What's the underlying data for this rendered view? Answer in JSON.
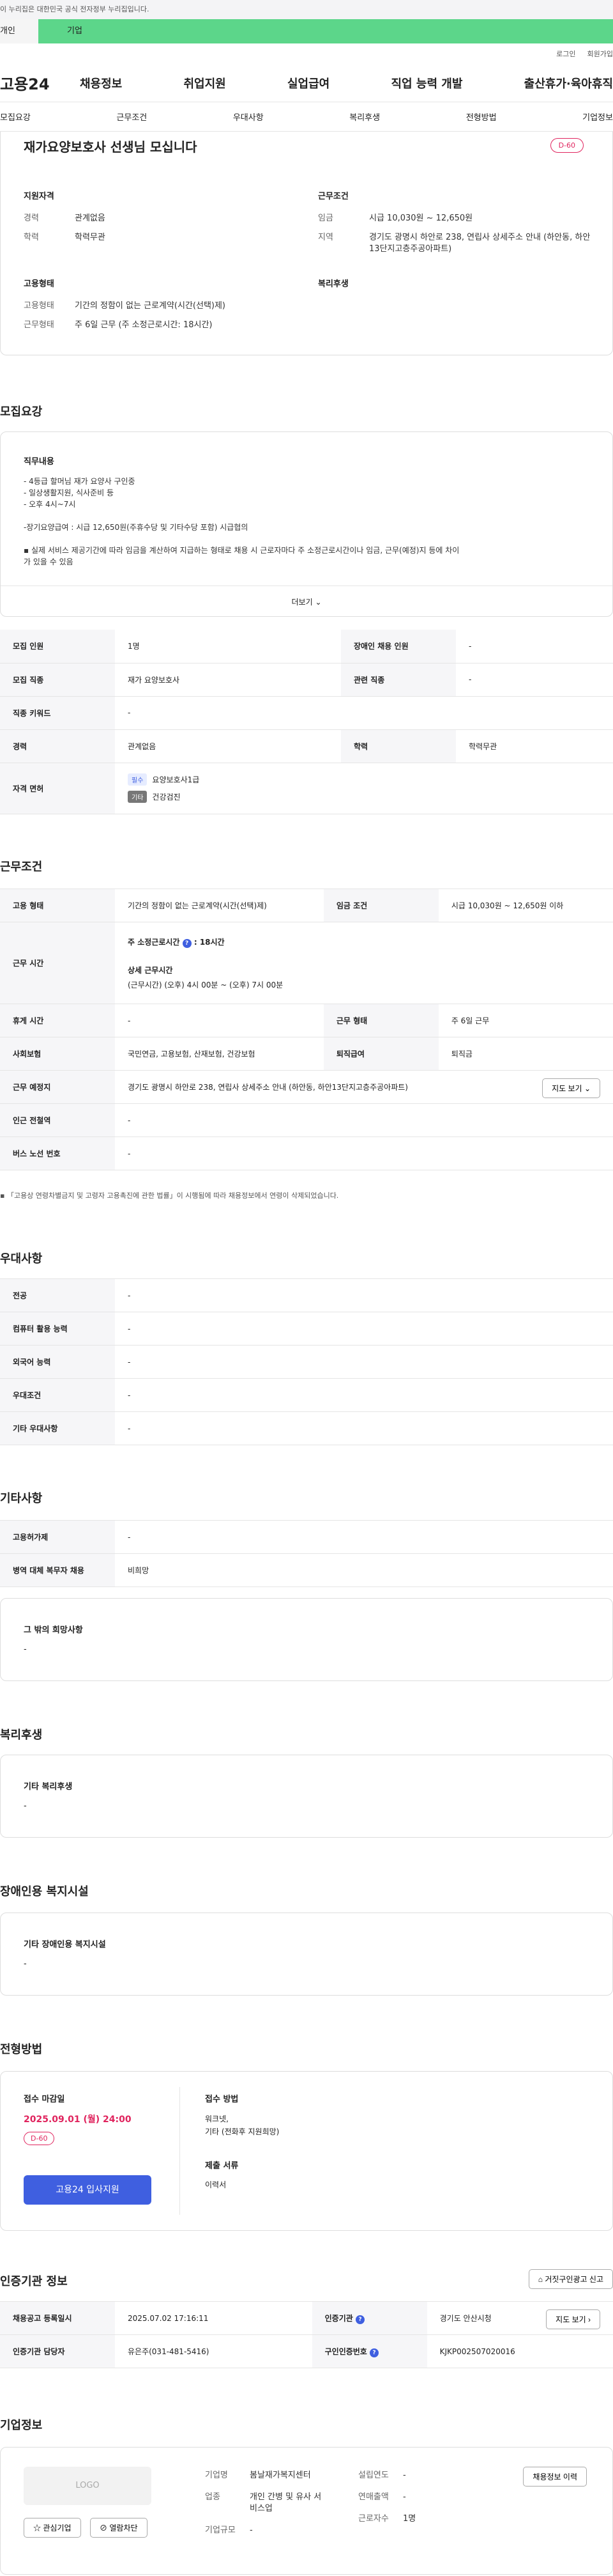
{
  "gov_banner": "이 누리집은 대한민국 공식 전자정부 누리집입니다.",
  "top_tabs": {
    "individual": "개인",
    "corporate": "기업"
  },
  "util": {
    "login": "로그인",
    "signup": "회원가입"
  },
  "gnb": {
    "logo": "고용24",
    "menu": [
      "채용정보",
      "취업지원",
      "실업급여",
      "직업 능력 개발",
      "출산휴가·육아휴직"
    ]
  },
  "subnav": [
    "모집요강",
    "근무조건",
    "우대사항",
    "복리후생",
    "전형방법",
    "기업정보"
  ],
  "header": {
    "title": "재가요양보호사 선생님 모십니다",
    "dday": "D-60",
    "qual_head": "지원자격",
    "qual": [
      {
        "k": "경력",
        "v": "관계없음"
      },
      {
        "k": "학력",
        "v": "학력무관"
      }
    ],
    "cond_head": "근무조건",
    "cond": [
      {
        "k": "임금",
        "v": "시급 10,030원 ~ 12,650원"
      },
      {
        "k": "지역",
        "v": "경기도 광명시 하안로 238, 연립사 상세주소 안내 (하안동, 하안13단지고층주공아파트)"
      }
    ],
    "emp_head": "고용형태",
    "emp": [
      {
        "k": "고용형태",
        "v": "기간의 정함이 없는 근로계약(시간(선택)제)"
      },
      {
        "k": "근무형태",
        "v": "주 6일 근무 (주 소정근로시간: 18시간)"
      }
    ],
    "welfare_head": "복리후생"
  },
  "recruit": {
    "title": "모집요강",
    "duty_head": "직무내용",
    "duty_lines": [
      "- 4등급 할머님 재가 요양사 구인중",
      "- 일상생활지원, 식사준비 등",
      "- 오후 4시~7시",
      "",
      "-장기요양급여 : 시급 12,650원(주휴수당 및 기타수당 포함) 시급협의",
      "",
      "▪ 실제 서비스 제공기간에 따라 임금을 계산하여 지급하는 형태로 채용 시 근로자마다 주 소정근로시간이나 임금, 근무(예정)지 등에 차이",
      "가 있을 수 있음"
    ],
    "more": "더보기",
    "rows": [
      {
        "h1": "모집 인원",
        "v1": "1명",
        "h2": "장애인 채용 인원",
        "v2": "-"
      },
      {
        "h1": "모집 직종",
        "v1": "재가 요양보호사",
        "h2": "관련 직종",
        "v2": "-"
      },
      {
        "h1": "직종 키워드",
        "v1": "-"
      },
      {
        "h1": "경력",
        "v1": "관계없음",
        "h2": "학력",
        "v2": "학력무관"
      }
    ],
    "license_head": "자격 면허",
    "licenses": [
      {
        "tag": "필수",
        "name": "요양보호사1급"
      },
      {
        "tag": "기타",
        "name": "건강검진"
      }
    ]
  },
  "work": {
    "title": "근무조건",
    "emp_type_h": "고용 형태",
    "emp_type": "기간의 정함이 없는 근로계약(시간(선택)제)",
    "wage_h": "임금 조건",
    "wage": "시급 10,030원 ~ 12,650원 이하",
    "hours_h": "근무 시간",
    "hours_main": "주 소정근로시간",
    "hours_val": ": 18시간",
    "hours_detail_h": "상세 근무시간",
    "hours_detail": "(근무시간) (오후) 4시 00분 ~ (오후) 7시 00분",
    "break_h": "휴게 시간",
    "break": "-",
    "shift_h": "근무 형태",
    "shift": "주 6일 근무",
    "ins_h": "사회보험",
    "ins": "국민연금, 고용보험, 산재보험, 건강보험",
    "sev_h": "퇴직급여",
    "sev": "퇴직금",
    "place_h": "근무 예정지",
    "place": "경기도 광명시 하안로 238, 연립사 상세주소 안내 (하안동, 하안13단지고층주공아파트)",
    "map_btn": "지도 보기",
    "subway_h": "인근 전철역",
    "subway": "-",
    "bus_h": "버스 노선 번호",
    "bus": "-",
    "note": "▪ 「고용상 연령차별금지 및 고령자 고용촉진에 관한 법률」이 시행됨에 따라 채용정보에서 연령이 삭제되었습니다."
  },
  "pref": {
    "title": "우대사항",
    "rows": [
      {
        "h": "전공",
        "v": "-"
      },
      {
        "h": "컴퓨터 활용 능력",
        "v": "-"
      },
      {
        "h": "외국어 능력",
        "v": "-"
      },
      {
        "h": "우대조건",
        "v": "-"
      },
      {
        "h": "기타 우대사항",
        "v": "-"
      }
    ]
  },
  "etc": {
    "title": "기타사항",
    "rows": [
      {
        "h": "고용허가제",
        "v": "-"
      },
      {
        "h": "병역 대체 복무자 채용",
        "v": "비희망"
      }
    ],
    "other_head": "그 밖의 희망사항",
    "other_val": "-"
  },
  "welfare": {
    "title": "복리후생",
    "head": "기타 복리후생",
    "val": "-"
  },
  "disabled": {
    "title": "장애인용 복지시설",
    "head": "기타 장애인용 복지시설",
    "val": "-"
  },
  "selection": {
    "title": "전형방법",
    "deadline_head": "접수 마감일",
    "deadline": "2025.09.01 (월) 24:00",
    "dday": "D-60",
    "apply_btn": "고용24 입사지원",
    "method_head": "접수 방법",
    "method_lines": [
      "워크넷,",
      "기타 (전화후 지원희망)"
    ],
    "docs_head": "제출 서류",
    "docs": "이력서"
  },
  "cert": {
    "title": "인증기관 정보",
    "report_btn": "거짓구인광고 신고",
    "r1": {
      "h1": "채용공고 등록일시",
      "v1": "2025.07.02 17:16:11",
      "h2": "인증기관",
      "v2": "경기도 안산시청",
      "btn": "지도 보기"
    },
    "r2": {
      "h1": "인증기관 담당자",
      "v1": "유은주(031-481-5416)",
      "h2": "구인인증번호",
      "v2": "KJKP002507020016"
    }
  },
  "company": {
    "title": "기업정보",
    "logo": "LOGO",
    "interest_btn": "관심기업",
    "block_btn": "열람차단",
    "fields": [
      {
        "k": "기업명",
        "v": "봄날재가복지센터"
      },
      {
        "k": "업종",
        "v": "개인 간병 및 유사 서비스업"
      },
      {
        "k": "기업규모",
        "v": "-"
      }
    ],
    "fields2": [
      {
        "k": "설립연도",
        "v": "-"
      },
      {
        "k": "연매출액",
        "v": "-"
      },
      {
        "k": "근로자수",
        "v": "1명"
      }
    ],
    "history_btn": "채용정보 이력"
  }
}
